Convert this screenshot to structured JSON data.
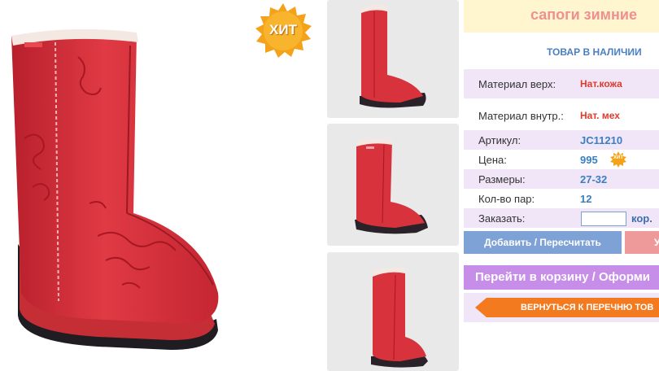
{
  "product": {
    "title": "сапоги зимние",
    "stock_status": "ТОВАР В НАЛИЧИИ",
    "hit_badge": "ХИТ"
  },
  "images": {
    "main_alt": "red-boot-photo",
    "thumbnails": [
      "boot-thumb-1",
      "boot-thumb-2",
      "boot-thumb-3"
    ]
  },
  "specs": [
    {
      "label": "Материал верх:",
      "value": "Нат.кожа"
    },
    {
      "label": "Материал внутр.:",
      "value": "Нат. мех"
    },
    {
      "label": "Артикул:",
      "value": "JC11210"
    },
    {
      "label": "Цена:",
      "value": "995",
      "badge": "ХИТ"
    },
    {
      "label": "Размеры:",
      "value": "27-32"
    },
    {
      "label": "Кол-во пар:",
      "value": "12"
    },
    {
      "label": "Заказать:",
      "value": "",
      "unit": "кор."
    }
  ],
  "actions": {
    "add_label": "Добавить / Пересчитать",
    "delete_label": "У",
    "cart_label": "Перейти в корзину / Оформи",
    "back_label": "ВЕРНУТЬСЯ К ПЕРЕЧНЮ ТОВ"
  },
  "colors": {
    "boot_red": "#d8323c",
    "badge_orange": "#f5a21b",
    "title_pink": "#ef9090",
    "accent_blue": "#3a7fc1",
    "accent_purple": "#c68ee9",
    "accent_orange": "#f47a1f"
  }
}
